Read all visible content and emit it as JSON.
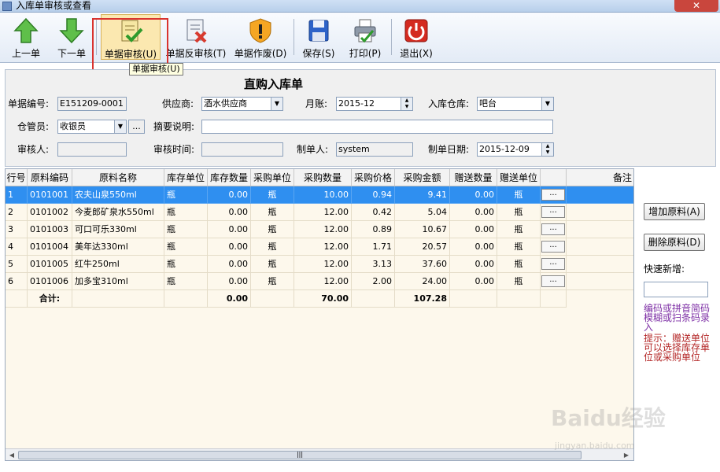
{
  "window": {
    "title": "入库单审核或查看",
    "close": "✕"
  },
  "toolbar": {
    "prev": "上一单",
    "next": "下一单",
    "audit": "单据审核(U)",
    "unaudit": "单据反审核(T)",
    "void": "单据作废(D)",
    "save": "保存(S)",
    "print": "打印(P)",
    "exit": "退出(X)"
  },
  "tooltip": "单据审核(U)",
  "form": {
    "heading": "直购入库单",
    "doc_no_label": "单据编号:",
    "doc_no": "E151209-0001",
    "supplier_label": "供应商:",
    "supplier": "酒水供应商",
    "period_label": "月账:",
    "period": "2015-12",
    "warehouse_label": "入库仓库:",
    "warehouse": "吧台",
    "keeper_label": "仓管员:",
    "keeper": "收银员",
    "keeper_more": "...",
    "summary_label": "摘要说明:",
    "summary": "",
    "auditor_label": "审核人:",
    "auditor": "",
    "audit_time_label": "审核时间:",
    "audit_time": "",
    "creator_label": "制单人:",
    "creator": "system",
    "date_label": "制单日期:",
    "date": "2015-12-09"
  },
  "table": {
    "headers": [
      "行号",
      "原料编码",
      "原料名称",
      "库存单位",
      "库存数量",
      "采购单位",
      "采购数量",
      "采购价格",
      "采购金额",
      "赠送数量",
      "赠送单位",
      "",
      "备注"
    ],
    "rows": [
      [
        "1",
        "0101001",
        "农夫山泉550ml",
        "瓶",
        "0.00",
        "瓶",
        "10.00",
        "0.94",
        "9.41",
        "0.00",
        "瓶",
        "..."
      ],
      [
        "2",
        "0101002",
        "今麦郎矿泉水550ml",
        "瓶",
        "0.00",
        "瓶",
        "12.00",
        "0.42",
        "5.04",
        "0.00",
        "瓶",
        "..."
      ],
      [
        "3",
        "0101003",
        "可口可乐330ml",
        "瓶",
        "0.00",
        "瓶",
        "12.00",
        "0.89",
        "10.67",
        "0.00",
        "瓶",
        "..."
      ],
      [
        "4",
        "0101004",
        "美年达330ml",
        "瓶",
        "0.00",
        "瓶",
        "12.00",
        "1.71",
        "20.57",
        "0.00",
        "瓶",
        "..."
      ],
      [
        "5",
        "0101005",
        "红牛250ml",
        "瓶",
        "0.00",
        "瓶",
        "12.00",
        "3.13",
        "37.60",
        "0.00",
        "瓶",
        "..."
      ],
      [
        "6",
        "0101006",
        "加多宝310ml",
        "瓶",
        "0.00",
        "瓶",
        "12.00",
        "2.00",
        "24.00",
        "0.00",
        "瓶",
        "..."
      ]
    ],
    "total": {
      "label": "合计:",
      "stock_qty": "0.00",
      "purchase_qty": "70.00",
      "amount": "107.28"
    }
  },
  "side": {
    "add": "增加原料(A)",
    "delete": "删除原料(D)",
    "quick_label": "快速新增:",
    "hint1": "编码或拼音简码模糊或扫条码录入",
    "hint2": "提示：赠送单位可以选择库存单位或采购单位"
  },
  "watermark": {
    "brand": "Baidu经验",
    "url": "jingyan.baidu.com"
  }
}
